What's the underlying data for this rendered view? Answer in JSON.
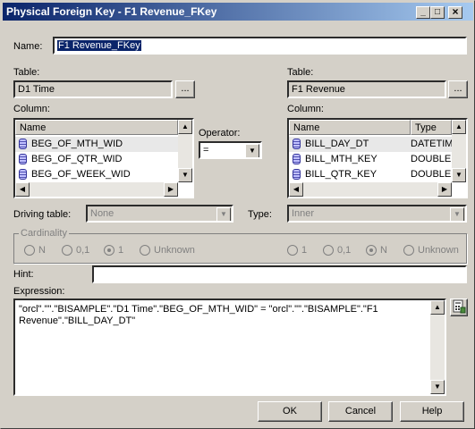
{
  "window": {
    "title": "Physical Foreign Key - F1 Revenue_FKey",
    "minimize": "_",
    "maximize": "□",
    "close": "×"
  },
  "name": {
    "label": "Name:",
    "value": "F1 Revenue_FKey"
  },
  "left": {
    "table_label": "Table:",
    "table_value": "D1 Time",
    "browse": "...",
    "column_label": "Column:",
    "header": "Name",
    "rows": [
      "BEG_OF_MTH_WID",
      "BEG_OF_QTR_WID",
      "BEG_OF_WEEK_WID"
    ]
  },
  "operator": {
    "label": "Operator:",
    "value": "="
  },
  "right": {
    "table_label": "Table:",
    "table_value": "F1 Revenue",
    "browse": "...",
    "column_label": "Column:",
    "header_name": "Name",
    "header_type": "Type",
    "rows": [
      {
        "name": "BILL_DAY_DT",
        "type": "DATETIM"
      },
      {
        "name": "BILL_MTH_KEY",
        "type": "DOUBLE"
      },
      {
        "name": "BILL_QTR_KEY",
        "type": "DOUBLE"
      }
    ]
  },
  "driving": {
    "label": "Driving table:",
    "value": "None"
  },
  "type": {
    "label": "Type:",
    "value": "Inner"
  },
  "cardinality": {
    "legend": "Cardinality",
    "left": [
      {
        "label": "N",
        "selected": false
      },
      {
        "label": "0,1",
        "selected": false
      },
      {
        "label": "1",
        "selected": true
      },
      {
        "label": "Unknown",
        "selected": false
      }
    ],
    "right": [
      {
        "label": "1",
        "selected": false
      },
      {
        "label": "0,1",
        "selected": false
      },
      {
        "label": "N",
        "selected": true
      },
      {
        "label": "Unknown",
        "selected": false
      }
    ]
  },
  "hint": {
    "label": "Hint:",
    "value": ""
  },
  "expression": {
    "label": "Expression:",
    "line1": "\"orcl\".\"\".\"BISAMPLE\".\"D1 Time\".\"BEG_OF_MTH_WID\" = \"orcl\".\"\".\"BISAMPLE\".\"F1",
    "line2": "Revenue\".\"BILL_DAY_DT\""
  },
  "buttons": {
    "ok": "OK",
    "cancel": "Cancel",
    "help": "Help"
  }
}
